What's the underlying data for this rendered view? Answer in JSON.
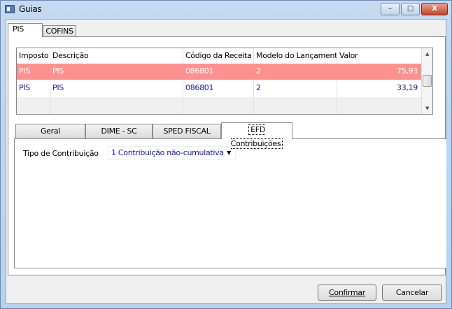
{
  "window": {
    "title": "Guias",
    "minimize": "–",
    "maximize": "□",
    "close": "X"
  },
  "outer_tabs": [
    {
      "label": "PIS"
    },
    {
      "label": "COFINS"
    }
  ],
  "grid": {
    "columns": [
      "Imposto",
      "Descrição",
      "Código da Receita",
      "Modelo do Lançamento",
      "Valor"
    ],
    "rows": [
      {
        "imposto": "PIS",
        "descricao": "PIS",
        "codigo": "086801",
        "modelo": "2",
        "valor": "75,93"
      },
      {
        "imposto": "PIS",
        "descricao": "PIS",
        "codigo": "086801",
        "modelo": "2",
        "valor": "33,19"
      }
    ],
    "selected_row_color": "#fe9090"
  },
  "inner_tabs": [
    {
      "label": "Geral"
    },
    {
      "label": "DIME - SC"
    },
    {
      "label": "SPED FISCAL"
    },
    {
      "label": "EFD Contribuições"
    }
  ],
  "efd": {
    "label": "Tipo de Contribuição",
    "value": "1 Contribuição não-cumulativa"
  },
  "buttons": {
    "confirm": "Confirmar",
    "cancel": "Cancelar"
  }
}
